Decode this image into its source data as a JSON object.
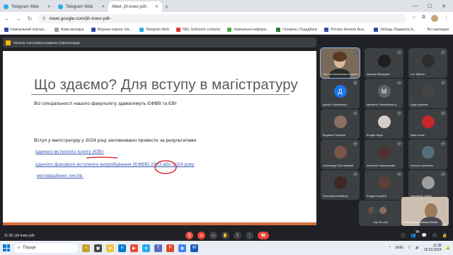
{
  "tabs": [
    {
      "label": "Telegram Web",
      "active": false
    },
    {
      "label": "Telegram Web",
      "active": false
    },
    {
      "label": "Meet: jih-inwo-ydh",
      "active": true
    }
  ],
  "address": {
    "url": "meet.google.com/jih-inwo-ydh"
  },
  "bookmarks": [
    {
      "label": "Навчальний портал...",
      "color": "#3949ab"
    },
    {
      "label": "Нова вкладка",
      "color": "#9e9e9e"
    },
    {
      "label": "Журнал оцінок: На...",
      "color": "#3949ab"
    },
    {
      "label": "Telegram Web",
      "color": "#2aabee"
    },
    {
      "label": "NKL Gofoonin contacts",
      "color": "#e53935"
    },
    {
      "label": "Навчально-інформ...",
      "color": "#4caf50"
    },
    {
      "label": "Головна | Ощадбанк",
      "color": "#2e7d32"
    },
    {
      "label": "Ротора Наталя Ана...",
      "color": "#3949ab"
    },
    {
      "label": "Лебедь Людмила А...",
      "color": "#3949ab"
    }
  ],
  "bookmarks_all": "Всі закладки",
  "presenter": {
    "label": "Наталія Анатоліївна Клименко (Презентація)"
  },
  "slide": {
    "title": "Що здаємо? Для вступу в магістратуру",
    "subtitle": "Всі спеціальності нашого факультету здаватимуть ЄФВВ та ЄВІ",
    "body": "Вступ у магістратуру у 2024 році заплановано провести за результатами",
    "link1": "єдиного вступного іспиту (ЄВІ)",
    "link2_a": "єдиного фахового вступного випробування ",
    "link2_b": "(ЄФВВ)",
    "link2_c": " 2023 або 2024 року",
    "link3": "мотиваційних листів."
  },
  "participants": [
    {
      "name": "Наталія Анатоліївна Клименко",
      "kind": "video",
      "initial": ""
    },
    {
      "name": "Максим Макаруків",
      "kind": "avatar",
      "initial": "",
      "color": "#1e1e1e"
    },
    {
      "name": "Lev Tattman",
      "kind": "avatar",
      "initial": "",
      "color": "#2d2d2d"
    },
    {
      "name": "Даниіл Прокопенко",
      "kind": "avatar",
      "initial": "Д",
      "color": "#1a73e8"
    },
    {
      "name": "Михайло Олексійович Б...",
      "kind": "avatar",
      "initial": "М",
      "color": "#5f6368"
    },
    {
      "name": "Гудзь Максим",
      "kind": "avatar",
      "initial": "",
      "color": "#444"
    },
    {
      "name": "Bogdana Petrasiuk",
      "kind": "avatar",
      "initial": "",
      "color": "#8d6e63"
    },
    {
      "name": "Богдан Ящук",
      "kind": "avatar",
      "initial": "",
      "color": "#d7ccc8"
    },
    {
      "name": "ваня попов",
      "kind": "avatar",
      "initial": "",
      "color": "#c62828"
    },
    {
      "name": "Олександр Пустовойний",
      "kind": "avatar",
      "initial": "",
      "color": "#795548"
    },
    {
      "name": "Антоніна Терещенкова",
      "kind": "avatar",
      "initial": "",
      "color": "#4e342e"
    },
    {
      "name": "Наталія Гребенюк",
      "kind": "avatar",
      "initial": "",
      "color": "#546e7a"
    },
    {
      "name": "Ярослава Матвійчук",
      "kind": "avatar",
      "initial": "",
      "color": "#3e2723"
    },
    {
      "name": "Богдан Кочубей",
      "kind": "avatar",
      "initial": "",
      "color": "#5d4037"
    },
    {
      "name": "Volodymyr Obukh",
      "kind": "avatar",
      "initial": "",
      "color": "#9e9e9e"
    }
  ],
  "others": {
    "label": "Ще 30 осіб"
  },
  "self_tile": {
    "name": "Наталія Анатоліївна Рогова"
  },
  "call": {
    "time": "11:36",
    "code": "jih-inwo-ydh",
    "participants_count": "47"
  },
  "taskbar": {
    "search_label": "Пошук",
    "lang": "ENG",
    "time": "11:38",
    "date": "19.03.2024"
  },
  "colors": {
    "accent": "#d86d3c",
    "link": "#3a5ab5",
    "hangup": "#ea4335"
  }
}
